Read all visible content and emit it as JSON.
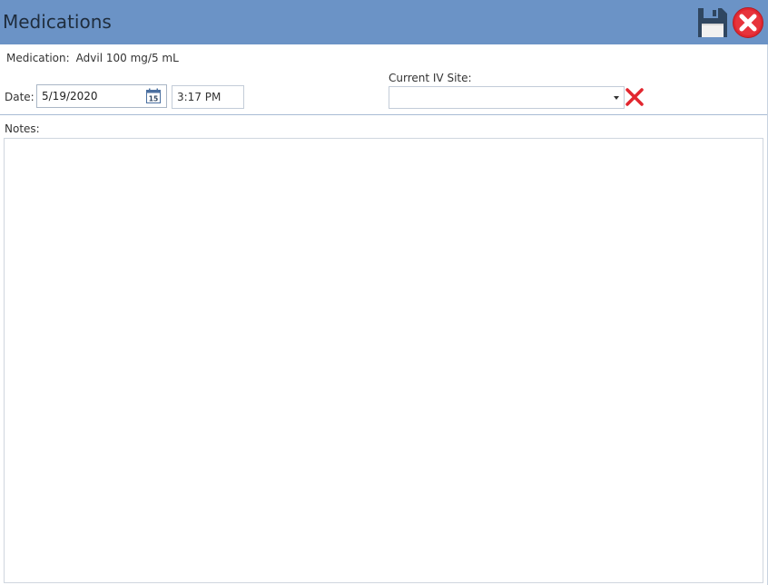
{
  "window": {
    "title": "Medications",
    "colors": {
      "titlebar": "#6b93c6",
      "divider": "#a9bcd4",
      "close": "#e2262f",
      "clear": "#e2262f",
      "save": "#2f4660"
    }
  },
  "toolbar": {
    "save_icon": "floppy-disk-icon",
    "close_icon": "close-circle-icon"
  },
  "medication": {
    "label": "Medication:",
    "value": "Advil 100 mg/5 mL"
  },
  "date": {
    "label": "Date:",
    "value": "5/19/2020",
    "calendar_icon": "calendar-icon",
    "calendar_day": "15"
  },
  "time": {
    "value": "3:17 PM"
  },
  "iv_site": {
    "label": "Current IV Site:",
    "value": "",
    "clear_icon": "clear-x-icon"
  },
  "notes": {
    "label": "Notes:",
    "value": ""
  }
}
